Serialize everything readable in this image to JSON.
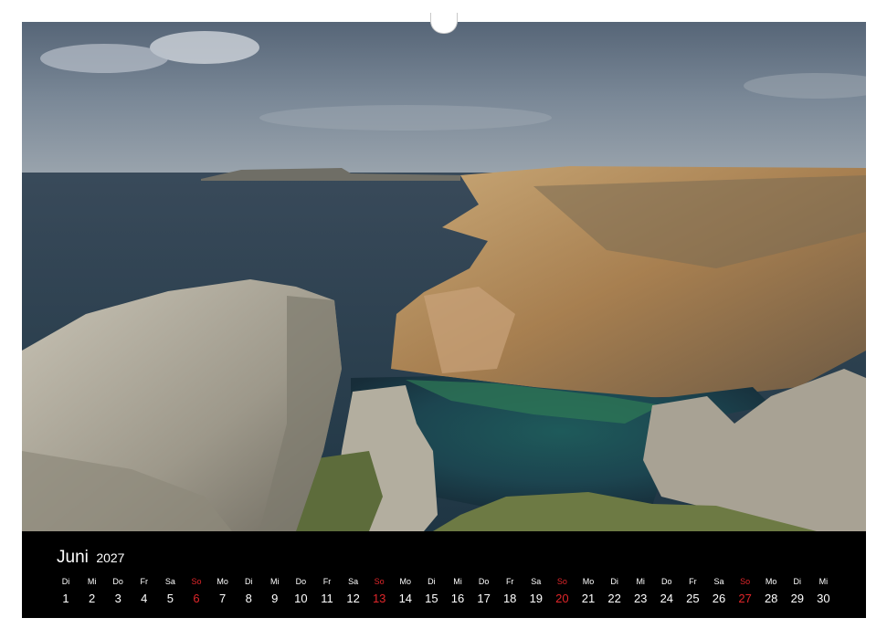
{
  "calendar": {
    "month": "Juni",
    "year": "2027",
    "accent_color": "#e0262a",
    "days": [
      {
        "dow": "Di",
        "num": "1",
        "sunday": false
      },
      {
        "dow": "Mi",
        "num": "2",
        "sunday": false
      },
      {
        "dow": "Do",
        "num": "3",
        "sunday": false
      },
      {
        "dow": "Fr",
        "num": "4",
        "sunday": false
      },
      {
        "dow": "Sa",
        "num": "5",
        "sunday": false
      },
      {
        "dow": "So",
        "num": "6",
        "sunday": true
      },
      {
        "dow": "Mo",
        "num": "7",
        "sunday": false
      },
      {
        "dow": "Di",
        "num": "8",
        "sunday": false
      },
      {
        "dow": "Mi",
        "num": "9",
        "sunday": false
      },
      {
        "dow": "Do",
        "num": "10",
        "sunday": false
      },
      {
        "dow": "Fr",
        "num": "11",
        "sunday": false
      },
      {
        "dow": "Sa",
        "num": "12",
        "sunday": false
      },
      {
        "dow": "So",
        "num": "13",
        "sunday": true
      },
      {
        "dow": "Mo",
        "num": "14",
        "sunday": false
      },
      {
        "dow": "Di",
        "num": "15",
        "sunday": false
      },
      {
        "dow": "Mi",
        "num": "16",
        "sunday": false
      },
      {
        "dow": "Do",
        "num": "17",
        "sunday": false
      },
      {
        "dow": "Fr",
        "num": "18",
        "sunday": false
      },
      {
        "dow": "Sa",
        "num": "19",
        "sunday": false
      },
      {
        "dow": "So",
        "num": "20",
        "sunday": true
      },
      {
        "dow": "Mo",
        "num": "21",
        "sunday": false
      },
      {
        "dow": "Di",
        "num": "22",
        "sunday": false
      },
      {
        "dow": "Mi",
        "num": "23",
        "sunday": false
      },
      {
        "dow": "Do",
        "num": "24",
        "sunday": false
      },
      {
        "dow": "Fr",
        "num": "25",
        "sunday": false
      },
      {
        "dow": "Sa",
        "num": "26",
        "sunday": false
      },
      {
        "dow": "So",
        "num": "27",
        "sunday": true
      },
      {
        "dow": "Mo",
        "num": "28",
        "sunday": false
      },
      {
        "dow": "Di",
        "num": "29",
        "sunday": false
      },
      {
        "dow": "Mi",
        "num": "30",
        "sunday": false
      }
    ]
  },
  "photo": {
    "subject": "coastal-cliffs-landscape"
  }
}
